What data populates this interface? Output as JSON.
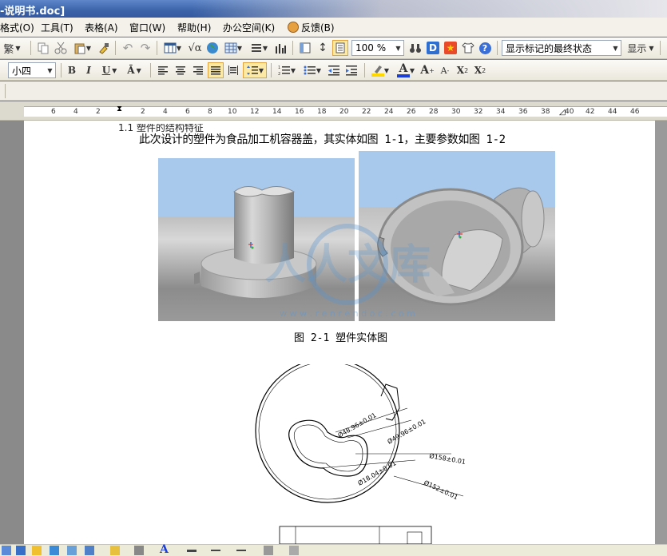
{
  "window": {
    "title": "-说明书.doc]"
  },
  "menu": {
    "items": [
      {
        "id": "format",
        "label": "格式(O)"
      },
      {
        "id": "tools",
        "label": "工具(T)"
      },
      {
        "id": "table",
        "label": "表格(A)"
      },
      {
        "id": "window",
        "label": "窗口(W)"
      },
      {
        "id": "help",
        "label": "帮助(H)"
      },
      {
        "id": "office",
        "label": "办公空间(K)"
      },
      {
        "id": "feedback",
        "label": "反馈(B)"
      }
    ]
  },
  "toolbar": {
    "traditional_label": "繁",
    "zoom_value": "100 %",
    "markup_state": "显示标记的最终状态",
    "show_label": "显示",
    "font_size": "小四",
    "bold_label": "B",
    "italic_label": "I",
    "underline_label": "U",
    "font_color_label": "A",
    "grow_font_label": "A",
    "shrink_font_label": "A",
    "superscript_label": "X",
    "superscript_mark": "2",
    "subscript_label": "X",
    "subscript_mark": "2",
    "highlight_color": "#ffd800",
    "font_color": "#1c3ed8"
  },
  "ruler": {
    "numbers": [
      "6",
      "4",
      "2",
      "2",
      "4",
      "6",
      "8",
      "10",
      "12",
      "14",
      "16",
      "18",
      "20",
      "22",
      "24",
      "26",
      "28",
      "30",
      "32",
      "34",
      "36",
      "38",
      "40",
      "42",
      "44",
      "46"
    ]
  },
  "document": {
    "heading_partial": "1.1  塑件的结构特征",
    "paragraph": "此次设计的塑件为食品加工机容器盖，其实体如图 1-1，主要参数如图 1-2",
    "figure_caption": "图 2-1  塑件实体图",
    "watermark_text": "人人文库",
    "watermark_url": "w w w . r e n r e n d o c . c o m",
    "dimensions": [
      "Ø48.96±0.01",
      "Ø49.96±0.01",
      "Ø158±0.01",
      "Ø18.04±0.01",
      "Ø152±0.01"
    ]
  }
}
